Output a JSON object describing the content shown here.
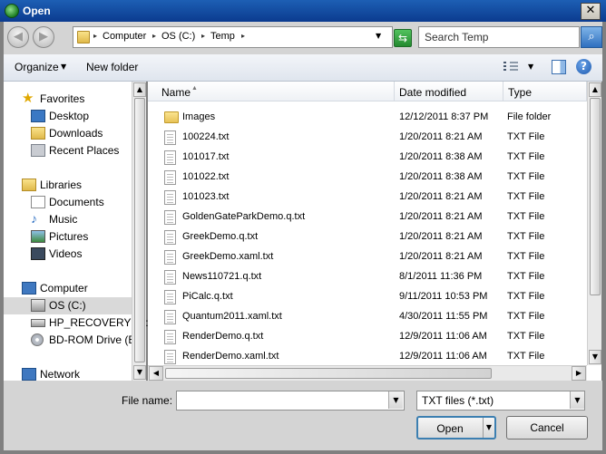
{
  "window": {
    "title": "Open",
    "close_glyph": "✕"
  },
  "address": {
    "back_glyph": "◀",
    "forward_glyph": "▶",
    "breadcrumbs": [
      "Computer",
      "OS (C:)",
      "Temp"
    ],
    "search_placeholder": "Search Temp"
  },
  "toolbar": {
    "organize_label": "Organize",
    "new_folder_label": "New folder",
    "help_glyph": "?"
  },
  "nav": {
    "favorites": {
      "label": "Favorites",
      "items": [
        "Desktop",
        "Downloads",
        "Recent Places"
      ]
    },
    "libraries": {
      "label": "Libraries",
      "items": [
        "Documents",
        "Music",
        "Pictures",
        "Videos"
      ]
    },
    "computer": {
      "label": "Computer",
      "items": [
        "OS (C:)",
        "HP_RECOVERY (D:",
        "BD-ROM Drive (E:)"
      ]
    },
    "network": {
      "label": "Network"
    }
  },
  "columns": {
    "name": "Name",
    "date": "Date modified",
    "type": "Type"
  },
  "files": [
    {
      "name": "Images",
      "date": "12/12/2011 8:37 PM",
      "type": "File folder",
      "icon": "folder-icon"
    },
    {
      "name": "100224.txt",
      "date": "1/20/2011 8:21 AM",
      "type": "TXT File",
      "icon": "text-file-icon"
    },
    {
      "name": "101017.txt",
      "date": "1/20/2011 8:38 AM",
      "type": "TXT File",
      "icon": "text-file-icon"
    },
    {
      "name": "101022.txt",
      "date": "1/20/2011 8:38 AM",
      "type": "TXT File",
      "icon": "text-file-icon"
    },
    {
      "name": "101023.txt",
      "date": "1/20/2011 8:21 AM",
      "type": "TXT File",
      "icon": "text-file-icon"
    },
    {
      "name": "GoldenGateParkDemo.q.txt",
      "date": "1/20/2011 8:21 AM",
      "type": "TXT File",
      "icon": "text-file-icon"
    },
    {
      "name": "GreekDemo.q.txt",
      "date": "1/20/2011 8:21 AM",
      "type": "TXT File",
      "icon": "text-file-icon"
    },
    {
      "name": "GreekDemo.xaml.txt",
      "date": "1/20/2011 8:21 AM",
      "type": "TXT File",
      "icon": "text-file-icon"
    },
    {
      "name": "News110721.q.txt",
      "date": "8/1/2011 11:36 PM",
      "type": "TXT File",
      "icon": "text-file-icon"
    },
    {
      "name": "PiCalc.q.txt",
      "date": "9/11/2011 10:53 PM",
      "type": "TXT File",
      "icon": "text-file-icon"
    },
    {
      "name": "Quantum2011.xaml.txt",
      "date": "4/30/2011 11:55 PM",
      "type": "TXT File",
      "icon": "text-file-icon"
    },
    {
      "name": "RenderDemo.q.txt",
      "date": "12/9/2011 11:06 AM",
      "type": "TXT File",
      "icon": "text-file-icon"
    },
    {
      "name": "RenderDemo.xaml.txt",
      "date": "12/9/2011 11:06 AM",
      "type": "TXT File",
      "icon": "text-file-icon"
    }
  ],
  "bottom": {
    "file_name_label": "File name:",
    "file_name_value": "",
    "file_type_value": "TXT files (*.txt)",
    "open_label": "Open",
    "cancel_label": "Cancel"
  }
}
